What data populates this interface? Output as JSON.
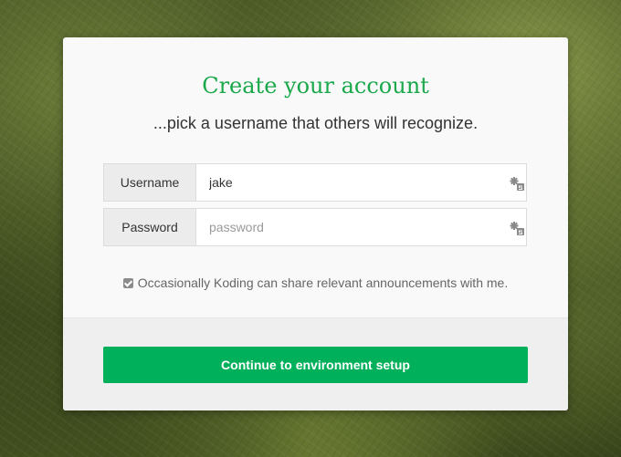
{
  "header": {
    "title": "Create your account",
    "subtitle": "...pick a username that others will recognize."
  },
  "form": {
    "username": {
      "label": "Username",
      "value": "jake",
      "placeholder": ""
    },
    "password": {
      "label": "Password",
      "value": "",
      "placeholder": "password"
    },
    "consent": {
      "checked": true,
      "label": "Occasionally Koding can share relevant announcements with me."
    }
  },
  "actions": {
    "continue_label": "Continue to environment setup"
  },
  "icons": {
    "field_helper": "password-manager-icon",
    "consent": "checkbox-checked-icon"
  },
  "colors": {
    "accent": "#1aa84b",
    "button": "#00b05a",
    "card": "#f9f9f9",
    "footer": "#efefef"
  }
}
